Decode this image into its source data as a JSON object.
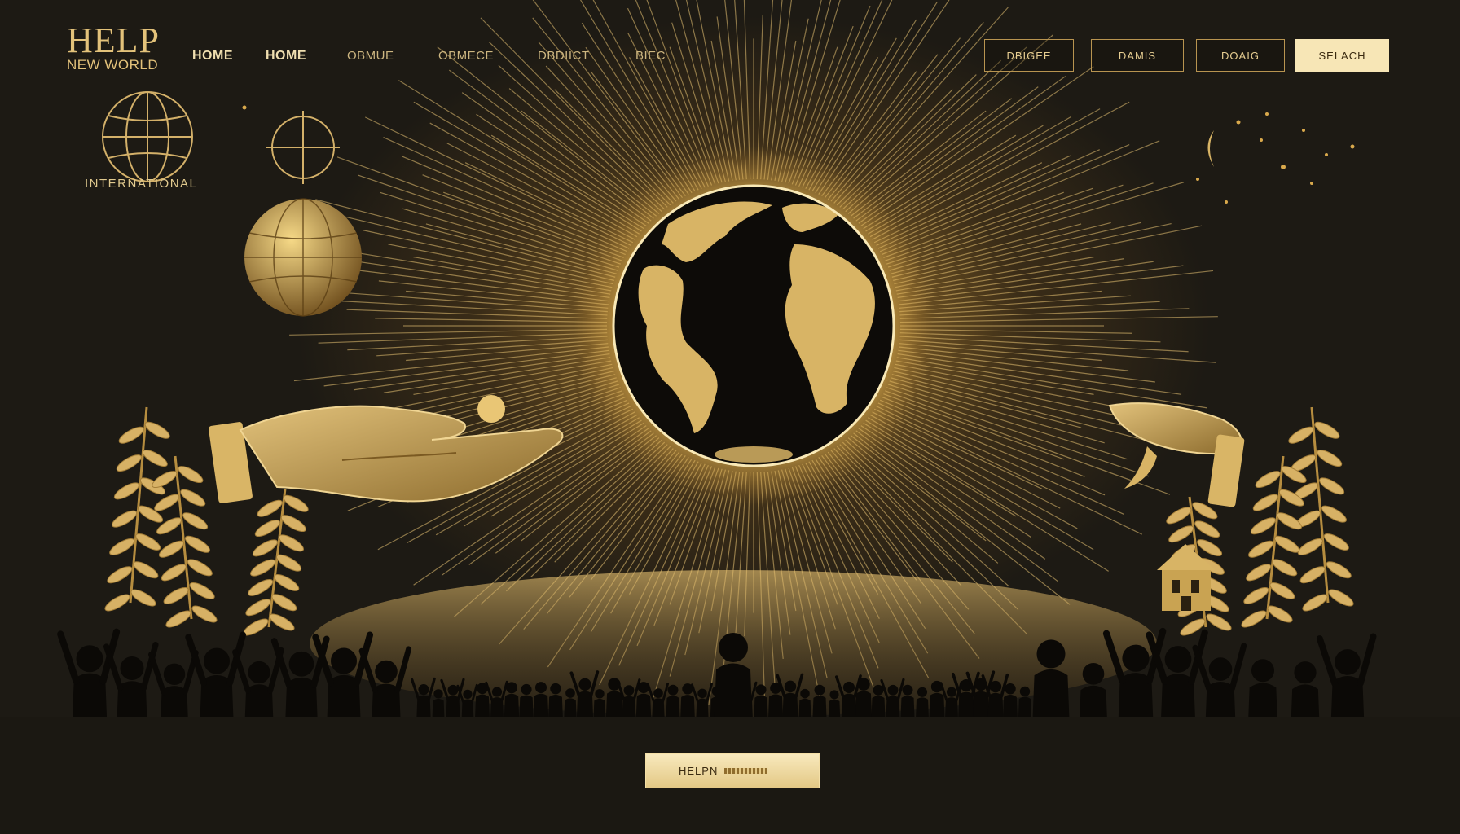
{
  "brand": {
    "title": "HELP",
    "subtitle": "NEW WORLD"
  },
  "nav": {
    "items": [
      "HOME",
      "HOME",
      "OBMUE",
      "OBMECE",
      "DBDIICT",
      "BIEC"
    ]
  },
  "header_buttons": [
    "DBIGEE",
    "DAMIS",
    "DOAIG",
    "SELACH"
  ],
  "badge": {
    "label": "INTERNATIONAL"
  },
  "cta": {
    "label": "HELPN"
  },
  "colors": {
    "gold": "#e3c27a",
    "light_gold": "#f7e6b6",
    "background": "#1b1812",
    "glow": "#fff4c8"
  },
  "icons": [
    "globe-outline-icon",
    "crosshair-icon",
    "globe-sphere-icon",
    "earth-globe",
    "giving-hand",
    "receiving-hand",
    "laurel-branch",
    "crowd-silhouette",
    "house-icon"
  ]
}
